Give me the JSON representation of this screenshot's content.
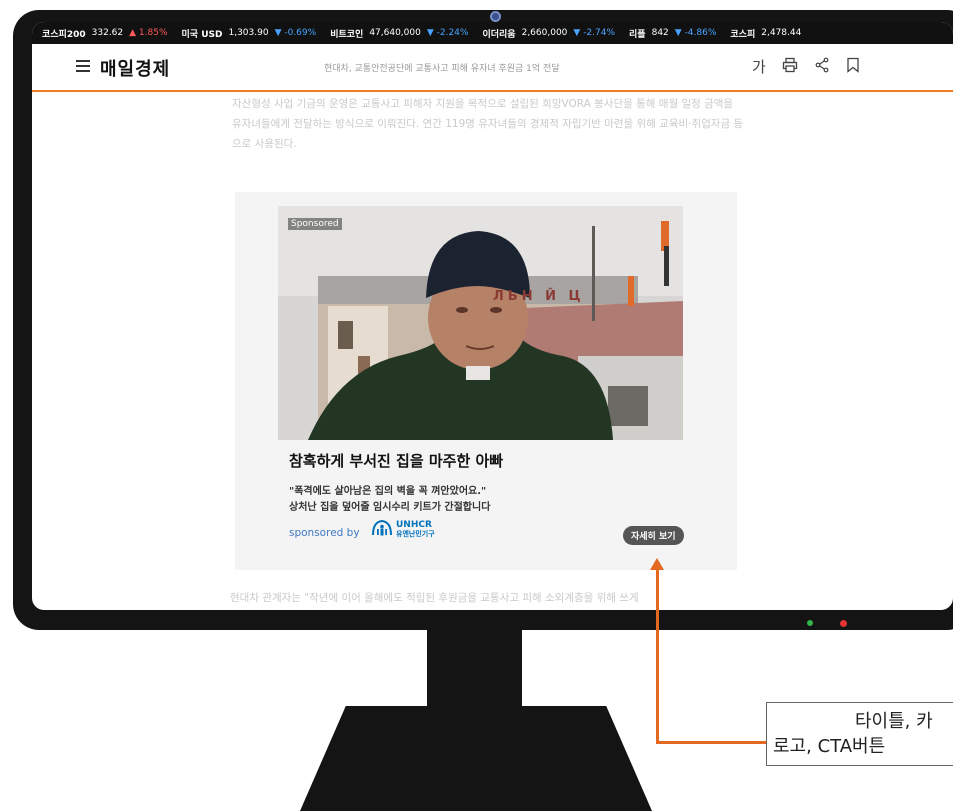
{
  "ticker": [
    {
      "name": "코스피200",
      "value": "332.62",
      "dir": "up",
      "change": "▲ 1.85%"
    },
    {
      "name": "미국 USD",
      "value": "1,303.90",
      "dir": "down",
      "change": "▼ -0.69%"
    },
    {
      "name": "비트코인",
      "value": "47,640,000",
      "dir": "down",
      "change": "▼ -2.24%"
    },
    {
      "name": "이더리움",
      "value": "2,660,000",
      "dir": "down",
      "change": "▼ -2.74%"
    },
    {
      "name": "리플",
      "value": "842",
      "dir": "down",
      "change": "▼ -4.86%"
    },
    {
      "name": "코스피",
      "value": "2,478.44",
      "dir": "none",
      "change": ""
    }
  ],
  "header": {
    "logo": "매일경제",
    "headline": "현대차, 교통안전공단에 교통사고 피해 유자녀 후원금 1억 전달",
    "font_icon": "가",
    "icons": [
      "hamburger-menu-icon",
      "print-icon",
      "share-icon",
      "bookmark-icon"
    ]
  },
  "article": {
    "para1": "자산형성 사업 기금의 운영은 교통사고 피해자 지원을 목적으로 설립된 희망VORA 봉사단을 통해 매월 일정 금액을 유자녀들에게 전달하는 방식으로 이뤄진다. 연간 119명 유자녀들의 경제적 자립기반 마련을 위해 교육비·취업자금 등으로 사용된다.",
    "para2": "현대차 관계자는 \"작년에 이어 올해에도 적립된 후원금을 교통사고 피해 소외계층을 위해 쓰게"
  },
  "ad": {
    "sponsored_tag": "Sponsored",
    "sign_text": "ЛЬН Й Ц",
    "title": "참혹하게 부서진 집을 마주한 아빠",
    "sub1": "\"폭격에도 살아남은 집의 벽을 꼭 껴안았어요.\"",
    "sub2": "상처난 집을 덮어줄 임시수리 키트가 간절합니다",
    "sponsored_by": "sponsored by",
    "brand_name": "UNHCR",
    "brand_sub": "유엔난민기구",
    "cta": "자세히 보기"
  },
  "annotation": {
    "line1": "타이틀, 카",
    "line2": "로고, CTA버튼"
  },
  "colors": {
    "accent": "#f07c1e",
    "arrow": "#e2691f",
    "up": "#ff5a5a",
    "down": "#4aa3ff"
  }
}
